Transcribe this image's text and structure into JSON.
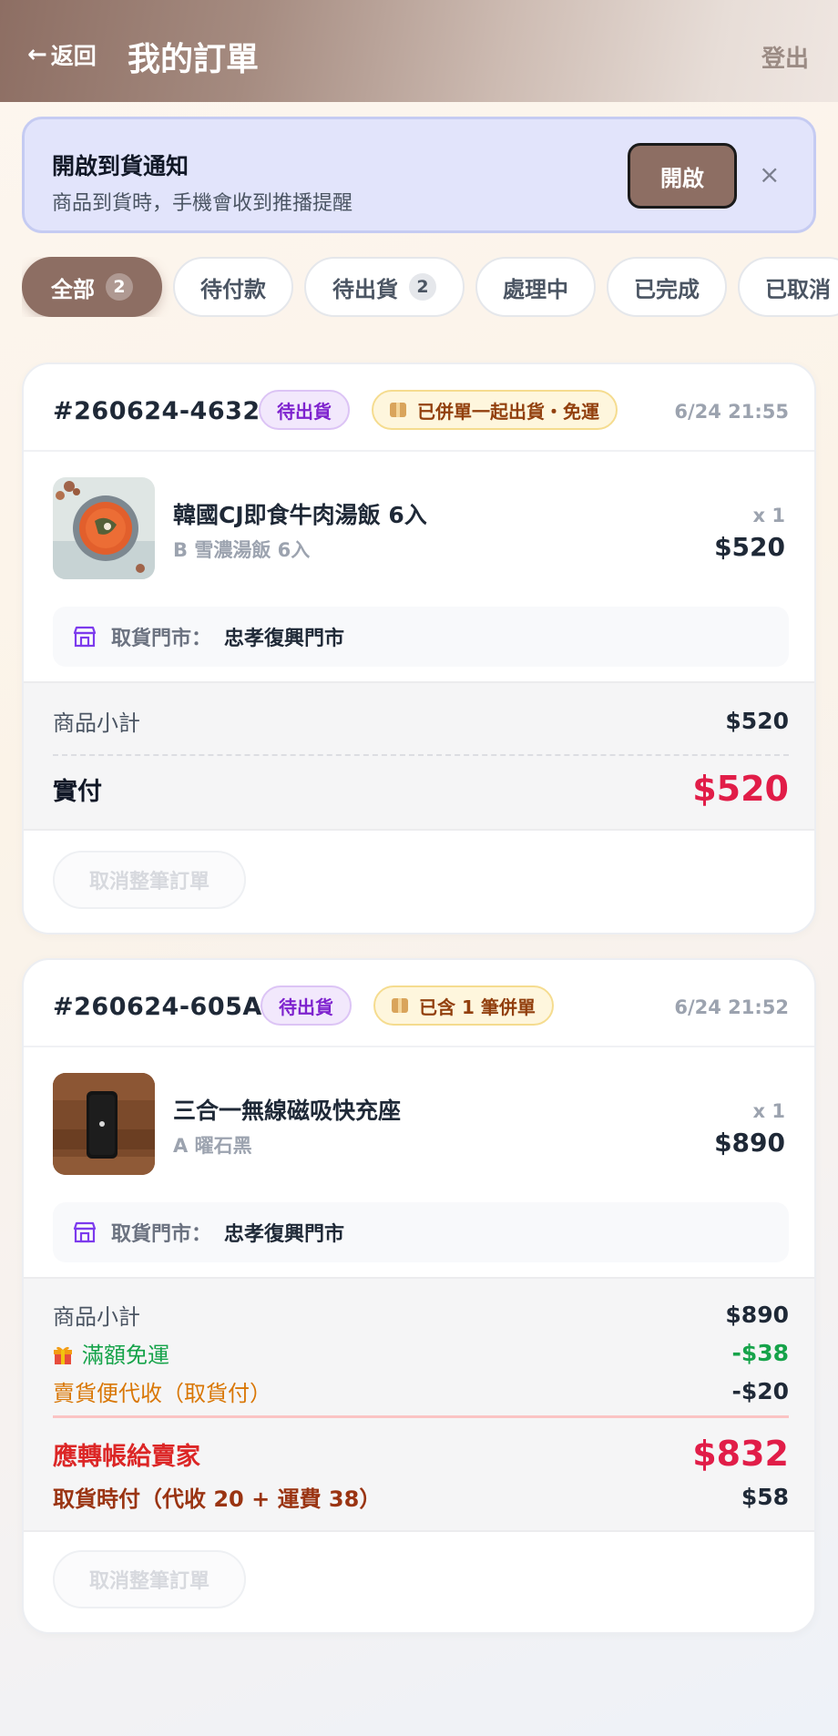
{
  "header": {
    "back_label": "返回",
    "title": "我的訂單",
    "logout_label": "登出"
  },
  "banner": {
    "title": "開啟到貨通知",
    "subtitle": "商品到貨時，手機會收到推播提醒",
    "button_label": "開啟",
    "close_glyph": "×"
  },
  "tabs": [
    {
      "label": "全部",
      "count": "2",
      "active": true
    },
    {
      "label": "待付款",
      "count": ""
    },
    {
      "label": "待出貨",
      "count": "2"
    },
    {
      "label": "處理中",
      "count": ""
    },
    {
      "label": "已完成",
      "count": ""
    },
    {
      "label": "已取消",
      "count": ""
    }
  ],
  "orders": [
    {
      "order_no": "#260624-4632",
      "status": "待出貨",
      "merge_note": "已併單一起出貨・免運",
      "time": "6/24 21:55",
      "item": {
        "name": "韓國CJ即食牛肉湯飯 6入",
        "variant": "B 雪濃湯飯 6入",
        "qty": "x 1",
        "price": "$520"
      },
      "pickup": {
        "label": "取貨門市：",
        "value": "忠孝復興門市"
      },
      "summary": {
        "subtotal_label": "商品小計",
        "subtotal": "$520",
        "paid_label": "實付",
        "paid": "$520"
      },
      "cancel_label": "取消整筆訂單"
    },
    {
      "order_no": "#260624-605A",
      "status": "待出貨",
      "merge_note": "已含 1 筆併單",
      "time": "6/24 21:52",
      "item": {
        "name": "三合一無線磁吸快充座",
        "variant": "A 曜石黑",
        "qty": "x 1",
        "price": "$890"
      },
      "pickup": {
        "label": "取貨門市：",
        "value": "忠孝復興門市"
      },
      "summary": {
        "subtotal_label": "商品小計",
        "subtotal": "$890",
        "free_ship_label": "滿額免運",
        "free_ship": "-$38",
        "cod_label": "賣貨便代收（取貨付）",
        "cod": "-$20",
        "transfer_label": "應轉帳給賣家",
        "transfer": "$832",
        "pickup_pay_label": "取貨時付（代收 20 + 運費 38）",
        "pickup_pay": "$58"
      },
      "cancel_label": "取消整筆訂單"
    }
  ],
  "colors": {
    "accent": "#8d6e63",
    "price_red": "#e11d48",
    "green": "#16a34a",
    "orange": "#d97706"
  },
  "icons": [
    "back-arrow-icon",
    "close-icon",
    "package-icon",
    "store-icon",
    "gift-icon"
  ]
}
